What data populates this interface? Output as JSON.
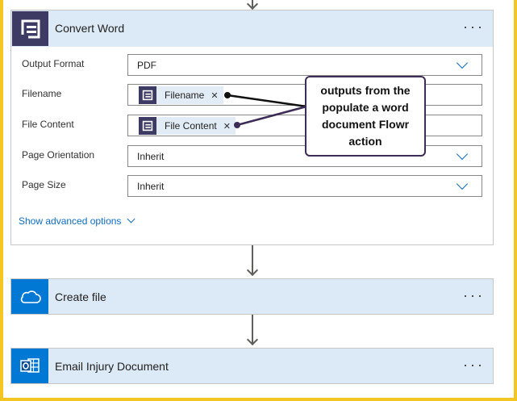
{
  "colors": {
    "accent": "#0f6cbd",
    "header_bg": "#dce9f6",
    "frame_border": "#f3c623",
    "word_icon_bg": "#3d3b63",
    "onedrive_icon_bg": "#0078d4",
    "outlook_icon_bg": "#0078d4"
  },
  "convert_card": {
    "title": "Convert Word",
    "icon": "word-converter-icon",
    "more_label": "···",
    "fields": [
      {
        "label": "Output Format",
        "value": "PDF",
        "type": "dropdown"
      },
      {
        "label": "Filename",
        "token": "Filename",
        "type": "token"
      },
      {
        "label": "File Content",
        "token": "File Content",
        "type": "token"
      },
      {
        "label": "Page Orientation",
        "value": "Inherit",
        "type": "dropdown"
      },
      {
        "label": "Page Size",
        "value": "Inherit",
        "type": "dropdown"
      }
    ],
    "advanced_options": "Show advanced options"
  },
  "callout": {
    "text": "outputs from the populate a word document Flowr action"
  },
  "create_file_card": {
    "title": "Create file",
    "icon": "onedrive-icon",
    "more_label": "···"
  },
  "email_card": {
    "title": "Email Injury Document",
    "icon": "outlook-icon",
    "more_label": "···"
  }
}
